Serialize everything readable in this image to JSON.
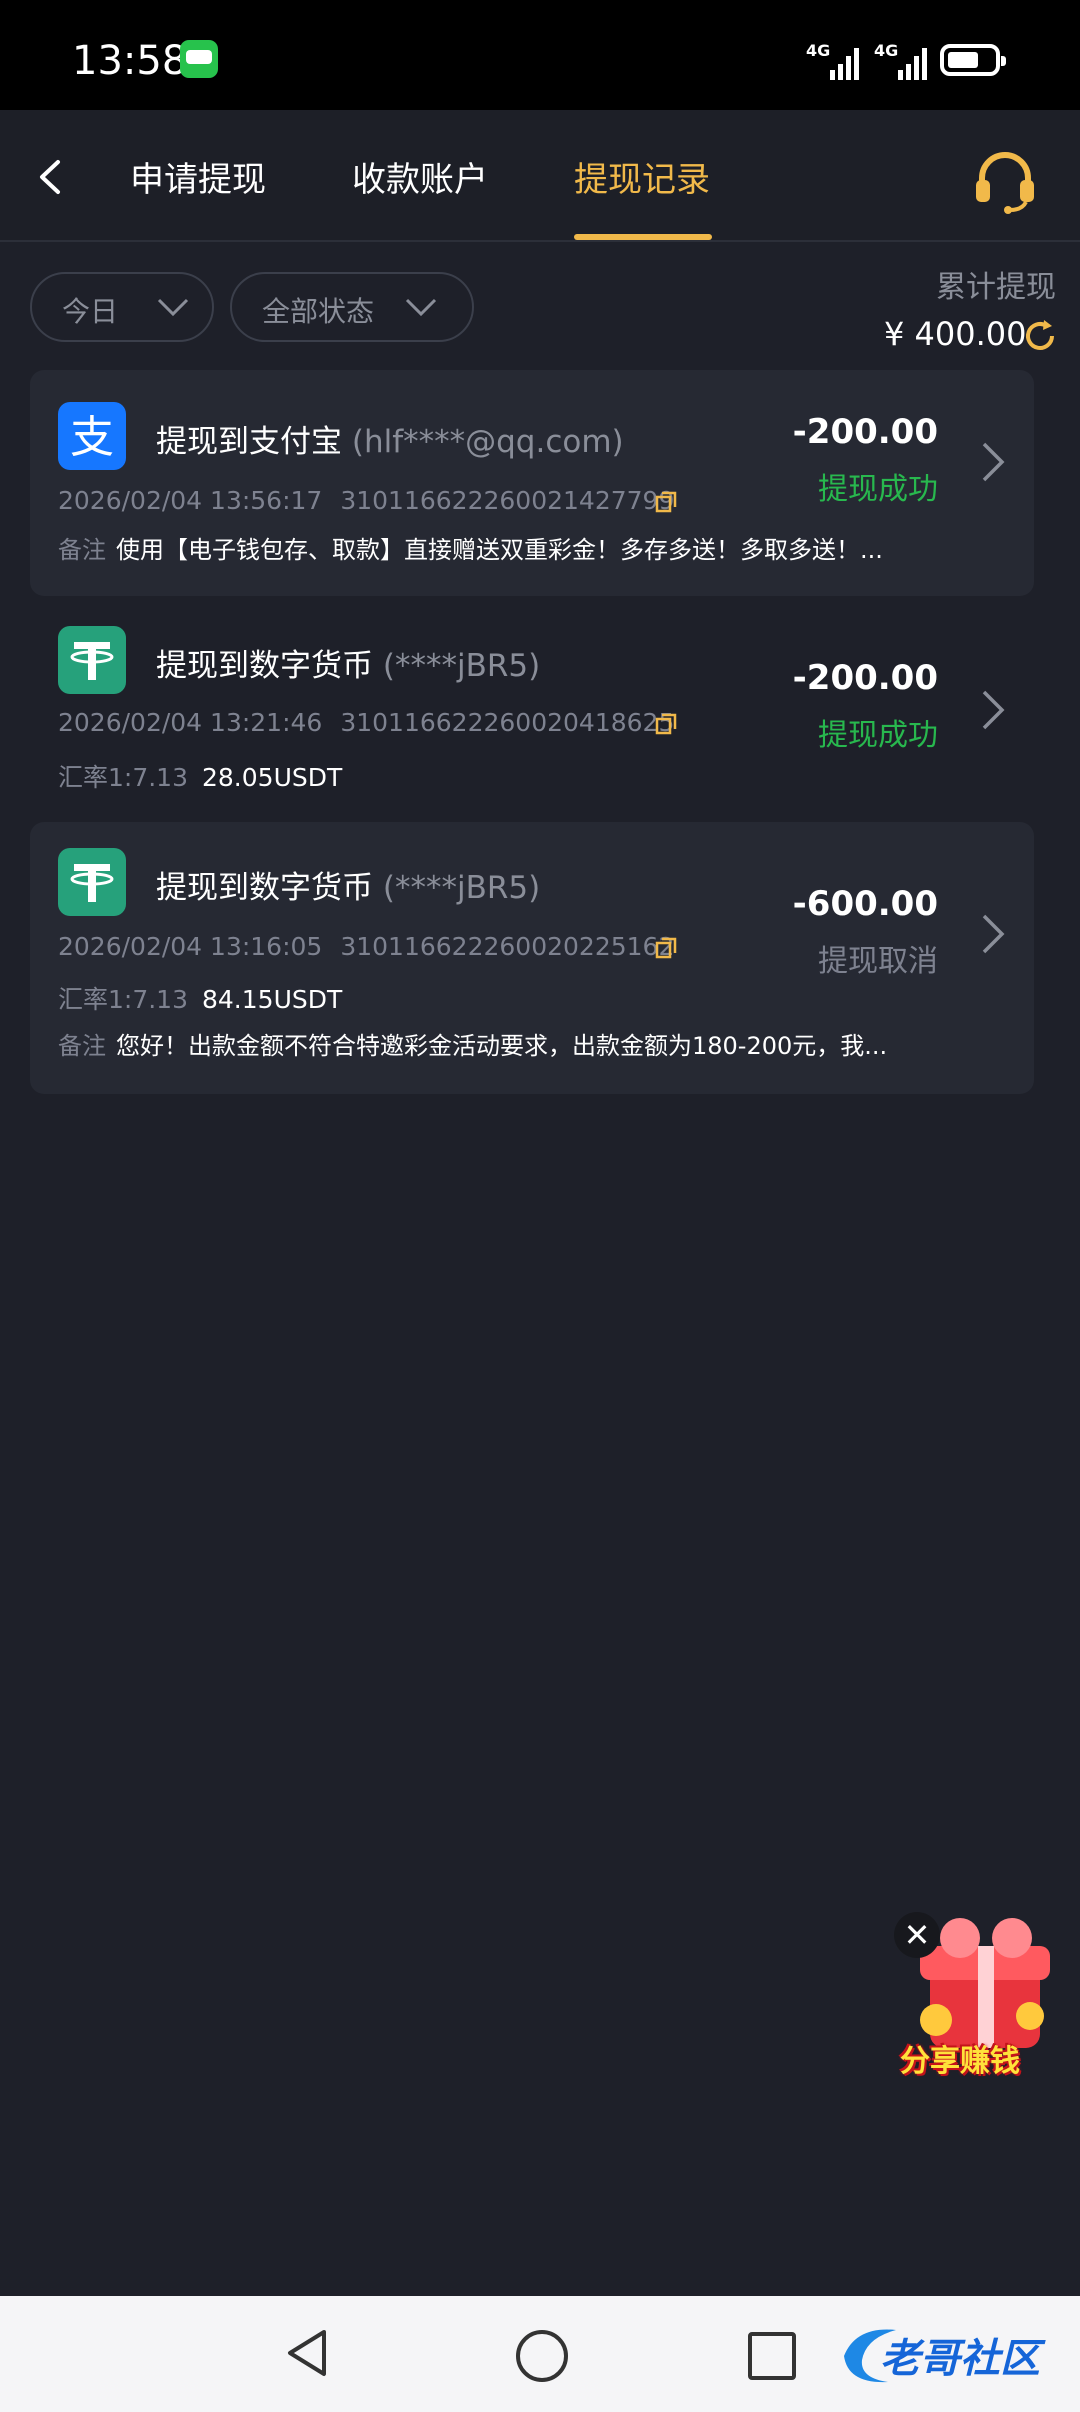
{
  "status_bar": {
    "time": "13:58",
    "net1": "4G",
    "net2": "4G"
  },
  "nav": {
    "tabs": [
      "申请提现",
      "收款账户",
      "提现记录"
    ],
    "active_tab": 2
  },
  "filters": {
    "date": "今日",
    "state": "全部状态"
  },
  "summary": {
    "label": "累计提现",
    "amount": "¥ 400.00"
  },
  "records": [
    {
      "channel": "提现到支付宝",
      "account": "(hlf****@qq.com)",
      "time": "2026/02/04 13:56:17",
      "order_no": "310116622260021427799",
      "amount": "-200.00",
      "status": "提现成功",
      "note_label": "备注",
      "note": "使用【电子钱包存、取款】直接赠送双重彩金！多存多送！多取多送！..."
    },
    {
      "channel": "提现到数字货币",
      "account": "(****jBR5)",
      "time": "2026/02/04 13:21:46",
      "order_no": "310116622260020418625",
      "amount": "-200.00",
      "status": "提现成功",
      "rate_label": "汇率1:7.13",
      "rate_value": "28.05USDT"
    },
    {
      "channel": "提现到数字货币",
      "account": "(****jBR5)",
      "time": "2026/02/04 13:16:05",
      "order_no": "310116622260020225162",
      "amount": "-600.00",
      "status": "提现取消",
      "rate_label": "汇率1:7.13",
      "rate_value": "84.15USDT",
      "note_label": "备注",
      "note": "您好！出款金额不符合特邀彩金活动要求，出款金额为180-200元，我..."
    }
  ],
  "promo": {
    "close": "✕",
    "text": "分享赚钱"
  },
  "watermark": {
    "text": "老哥社区"
  },
  "colors": {
    "accent": "#f1b94a",
    "success": "#28b84e",
    "bg": "#1e2029",
    "card": "#262933"
  }
}
